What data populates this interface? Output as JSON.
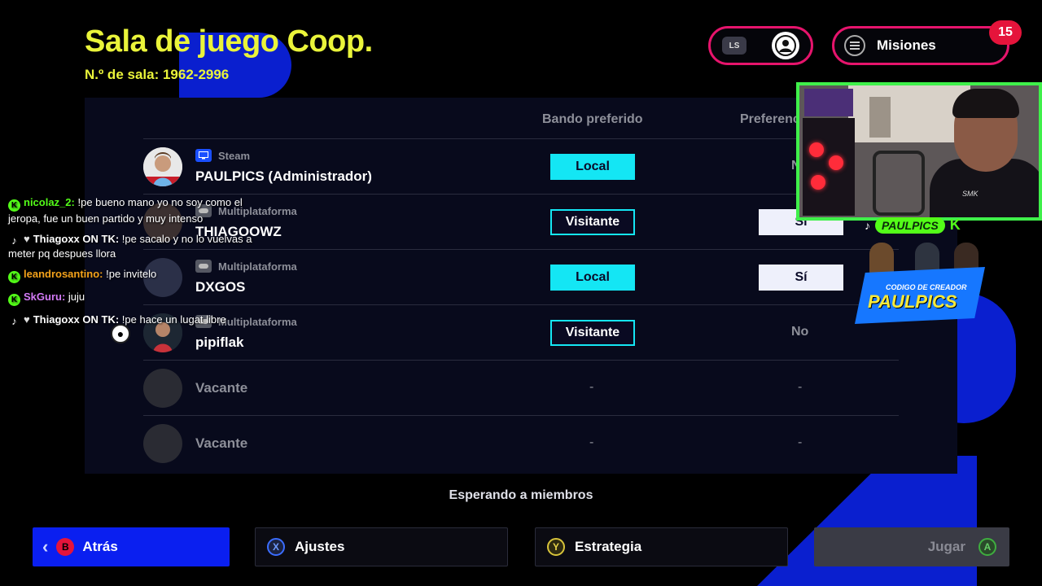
{
  "header": {
    "title": "Sala de juego Coop.",
    "room_number": "N.º de sala: 1962-2996",
    "ls_badge": "LS",
    "missions_label": "Misiones",
    "notification_count": "15"
  },
  "table": {
    "columns": [
      "Bando preferido",
      "Preferencia"
    ],
    "rows": [
      {
        "platform": "Steam",
        "platform_icon": "monitor-icon",
        "name": "PAULPICS (Administrador)",
        "side": "Local",
        "preference": "No"
      },
      {
        "platform": "Multiplataforma",
        "platform_icon": "gamepad-icon",
        "name": "THIAGOOWZ",
        "side": "Visitante",
        "preference": "Sí"
      },
      {
        "platform": "Multiplataforma",
        "platform_icon": "gamepad-icon",
        "name": "DXGOS",
        "side": "Local",
        "preference": "Sí"
      },
      {
        "platform": "Multiplataforma",
        "platform_icon": "gamepad-icon",
        "name": "pipiflak",
        "side": "Visitante",
        "preference": "No"
      },
      {
        "name": "Vacante",
        "side": "-",
        "preference": "-"
      },
      {
        "name": "Vacante",
        "side": "-",
        "preference": "-"
      }
    ]
  },
  "status": "Esperando a miembros",
  "actions": {
    "back": {
      "glyph": "B",
      "label": "Atrás"
    },
    "settings": {
      "glyph": "X",
      "label": "Ajustes"
    },
    "strategy": {
      "glyph": "Y",
      "label": "Estrategia"
    },
    "play": {
      "glyph": "A",
      "label": "Jugar"
    }
  },
  "chat": [
    {
      "source": "kick",
      "user": "nicolaz_2:",
      "text": " !pe bueno mano yo no soy como el jeropa, fue un buen partido y muy intenso"
    },
    {
      "source": "tiktok",
      "user": "Thiagoxx ON TK:",
      "text": " !pe sacalo y no lo vuelvas a meter pq despues llora"
    },
    {
      "source": "kick",
      "user": "leandrosantino:",
      "text": " !pe invitelo"
    },
    {
      "source": "kick",
      "user": "SkGuru:",
      "text": " juju"
    },
    {
      "source": "tiktok",
      "user": "Thiagoxx ON TK:",
      "text": " !pe hace un lugat libre"
    }
  ],
  "branding": {
    "handle": "PAULPICS",
    "kick_letter": "K",
    "creator_code_label": "CODIGO DE CREADOR",
    "creator_code": "PAULPICS",
    "shirt_logo": "SMK"
  },
  "colors": {
    "title_yellow": "#eaf43a",
    "local_cyan": "#14e6f4",
    "accent_pink": "#e6146c",
    "back_blue": "#0a1ff0",
    "kick_green": "#53fc18"
  }
}
